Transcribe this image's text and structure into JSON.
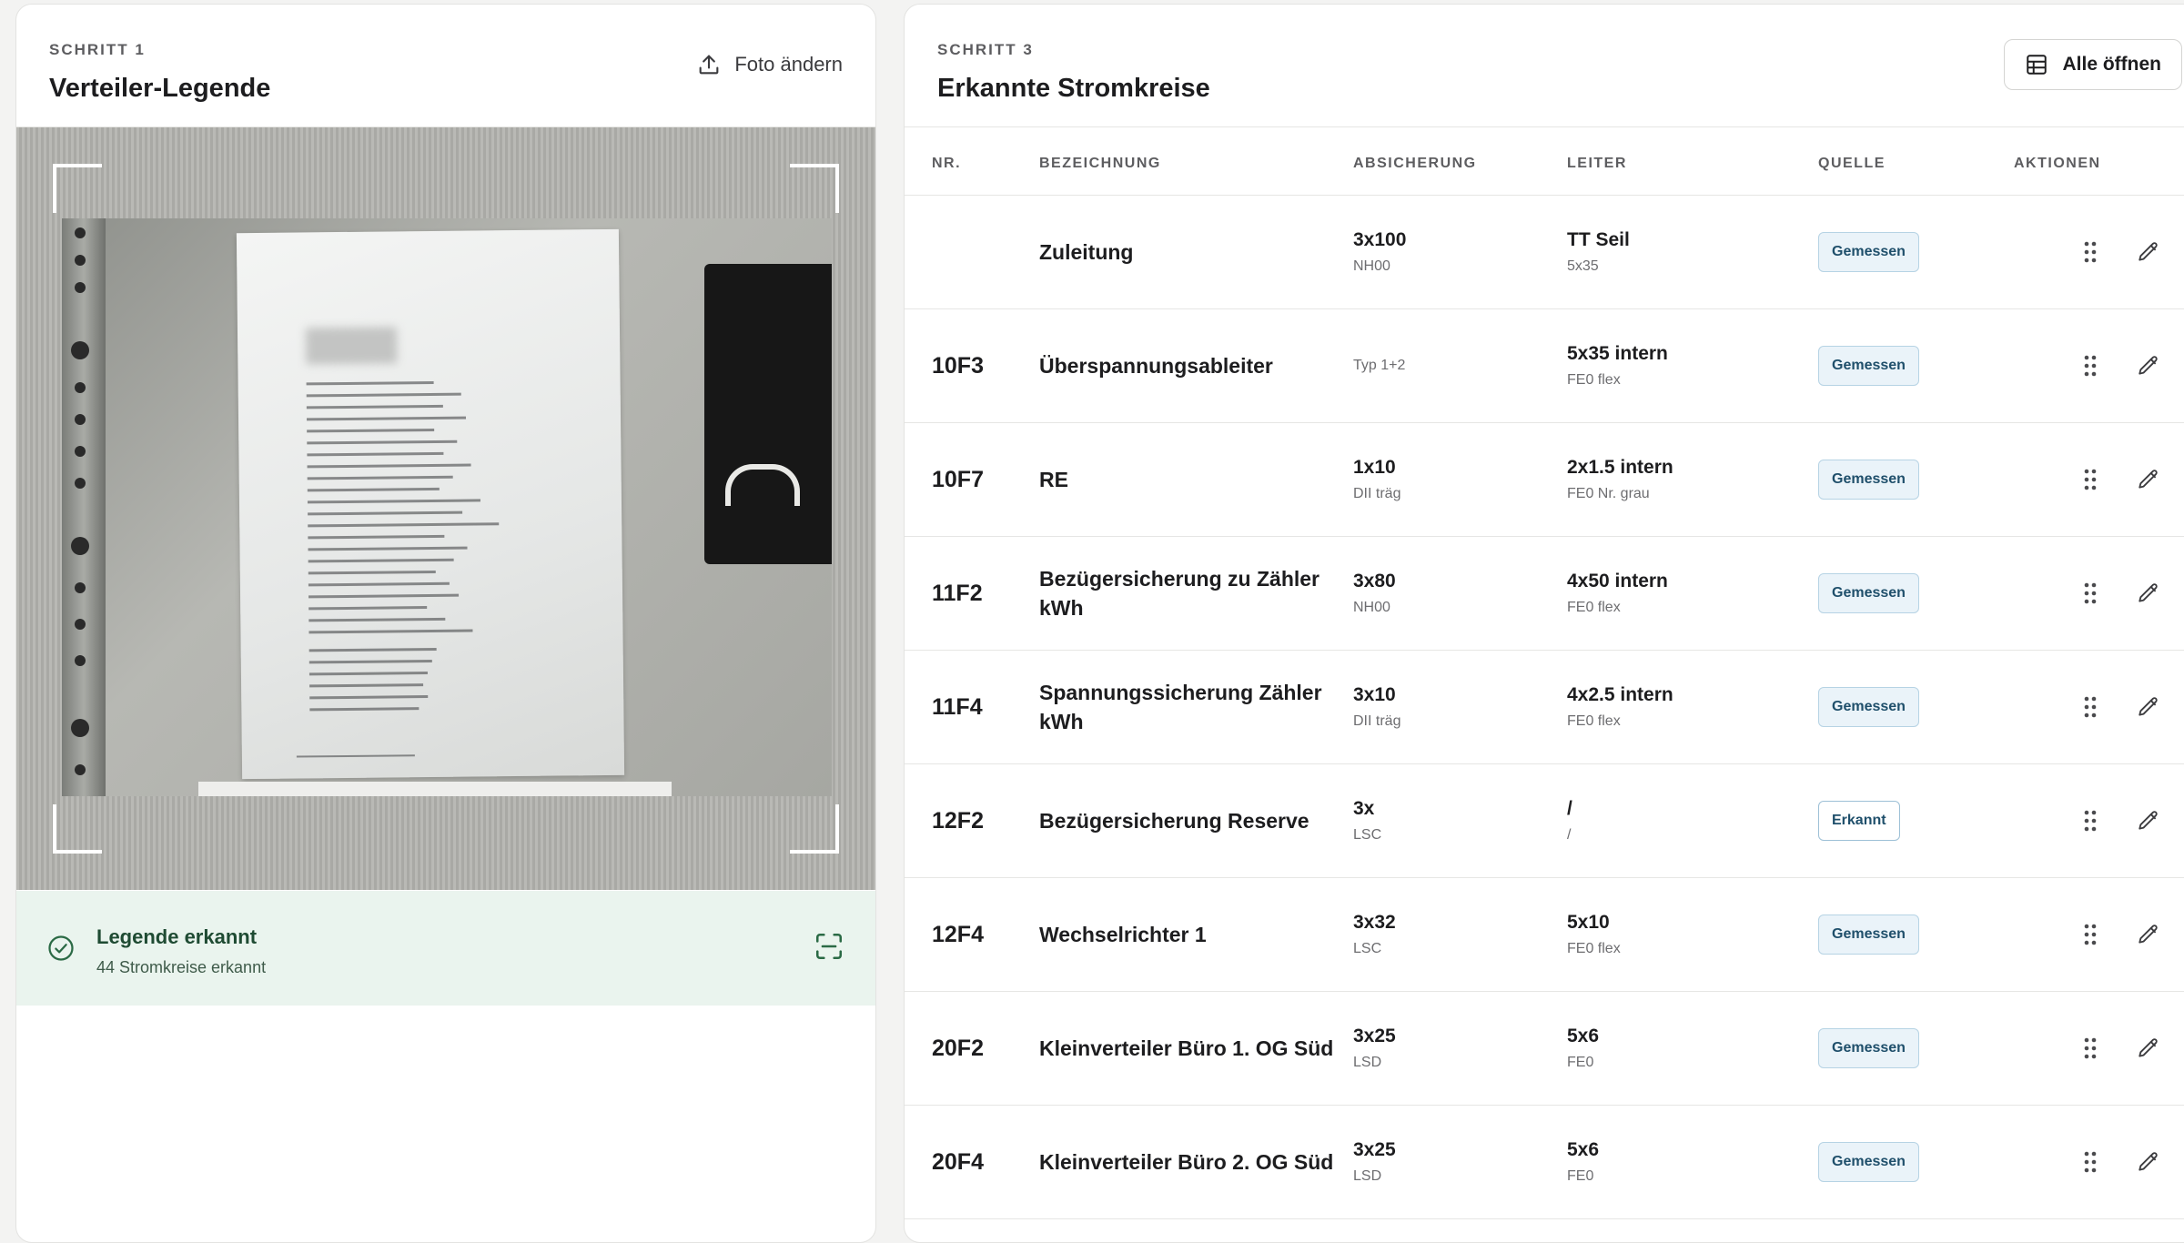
{
  "left_panel": {
    "step": "SCHRITT 1",
    "title": "Verteiler-Legende",
    "change_photo_label": "Foto ändern",
    "status": {
      "title": "Legende erkannt",
      "subtitle": "44 Stromkreise erkannt"
    }
  },
  "right_panel": {
    "step": "SCHRITT 3",
    "title": "Erkannte Stromkreise",
    "open_all_label": "Alle öffnen",
    "columns": {
      "nr": "NR.",
      "bezeichnung": "BEZEICHNUNG",
      "absicherung": "ABSICHERUNG",
      "leiter": "LEITER",
      "quelle": "QUELLE",
      "aktionen": "AKTIONEN"
    },
    "rows": [
      {
        "nr": "",
        "bezeichnung": "Zuleitung",
        "abs_main": "3x100",
        "abs_sub": "NH00",
        "lei_main": "TT Seil",
        "lei_sub": "5x35",
        "quelle": "Gemessen"
      },
      {
        "nr": "10F3",
        "bezeichnung": "Überspannungsableiter",
        "abs_main": "",
        "abs_sub": "Typ 1+2",
        "lei_main": "5x35 intern",
        "lei_sub": "FE0 flex",
        "quelle": "Gemessen"
      },
      {
        "nr": "10F7",
        "bezeichnung": "RE",
        "abs_main": "1x10",
        "abs_sub": "DII träg",
        "lei_main": "2x1.5 intern",
        "lei_sub": "FE0 Nr. grau",
        "quelle": "Gemessen"
      },
      {
        "nr": "11F2",
        "bezeichnung": "Bezügersicherung zu Zähler kWh",
        "abs_main": "3x80",
        "abs_sub": "NH00",
        "lei_main": "4x50 intern",
        "lei_sub": "FE0 flex",
        "quelle": "Gemessen"
      },
      {
        "nr": "11F4",
        "bezeichnung": "Spannungssicherung Zähler kWh",
        "abs_main": "3x10",
        "abs_sub": "DII träg",
        "lei_main": "4x2.5 intern",
        "lei_sub": "FE0 flex",
        "quelle": "Gemessen"
      },
      {
        "nr": "12F2",
        "bezeichnung": "Bezügersicherung Reserve",
        "abs_main": "3x",
        "abs_sub": "LSC",
        "lei_main": "/",
        "lei_sub": "/",
        "quelle": "Erkannt"
      },
      {
        "nr": "12F4",
        "bezeichnung": "Wechselrichter 1",
        "abs_main": "3x32",
        "abs_sub": "LSC",
        "lei_main": "5x10",
        "lei_sub": "FE0 flex",
        "quelle": "Gemessen"
      },
      {
        "nr": "20F2",
        "bezeichnung": "Kleinverteiler Büro 1. OG Süd",
        "abs_main": "3x25",
        "abs_sub": "LSD",
        "lei_main": "5x6",
        "lei_sub": "FE0",
        "quelle": "Gemessen"
      },
      {
        "nr": "20F4",
        "bezeichnung": "Kleinverteiler Büro 2. OG Süd",
        "abs_main": "3x25",
        "abs_sub": "LSD",
        "lei_main": "5x6",
        "lei_sub": "FE0",
        "quelle": "Gemessen"
      }
    ]
  },
  "colors": {
    "status_bg": "#eaf4ee",
    "status_text": "#1f4b33",
    "badge_bg": "#eaf3f9",
    "badge_text": "#1f4f6b"
  },
  "icons": {
    "upload": "upload-icon",
    "table": "table-icon",
    "check": "check-circle-icon",
    "scan": "scan-icon",
    "drag": "drag-handle-icon",
    "edit": "pencil-icon"
  }
}
